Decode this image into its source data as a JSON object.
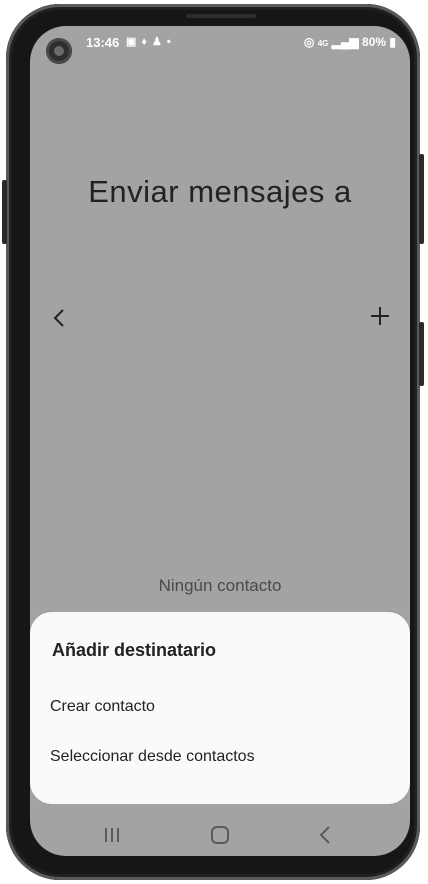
{
  "status_bar": {
    "time": "13:46",
    "left_icons": [
      "image-icon",
      "mic-icon",
      "snapchat-icon",
      "dot-icon"
    ],
    "right_icons": [
      "hotspot-icon",
      "lte-icon",
      "signal-icon"
    ],
    "battery": "80%"
  },
  "main": {
    "title": "Enviar mensajes a",
    "empty_text": "Ningún contacto"
  },
  "sheet": {
    "title": "Añadir destinatario",
    "items": [
      "Crear contacto",
      "Seleccionar desde contactos"
    ]
  },
  "nav_bar": {
    "icons": [
      "recent-apps-icon",
      "home-icon",
      "back-icon"
    ]
  }
}
